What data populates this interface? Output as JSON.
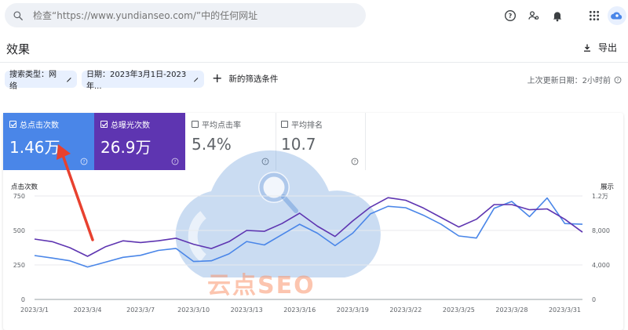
{
  "search": {
    "placeholder": "检查“https://www.yundianseo.com/”中的任何网址"
  },
  "header": {
    "title": "效果",
    "export_label": "导出"
  },
  "filters": {
    "search_type": "搜索类型：网络",
    "date": "日期：2023年3月1日-2023年...",
    "new_filter": "新的筛选条件",
    "last_updated": "上次更新日期：2小时前"
  },
  "metrics": [
    {
      "label": "总点击次数",
      "value": "1.46万",
      "checked": true,
      "color": "#4a86e8"
    },
    {
      "label": "总曝光次数",
      "value": "26.9万",
      "checked": true,
      "color": "#5e35b1"
    },
    {
      "label": "平均点击率",
      "value": "5.4%",
      "checked": false
    },
    {
      "label": "平均排名",
      "value": "10.7",
      "checked": false
    }
  ],
  "watermark": "云点SEO",
  "chart_data": {
    "type": "line",
    "left_axis_label": "点击次数",
    "right_axis_label": "展示",
    "left_ticks": [
      "750",
      "500",
      "250",
      "0"
    ],
    "right_ticks": [
      "1.2万",
      "8,000",
      "4,000",
      "0"
    ],
    "ylim_left": [
      0,
      750
    ],
    "ylim_right": [
      0,
      12000
    ],
    "x_tick_labels": [
      "2023/3/1",
      "2023/3/4",
      "2023/3/7",
      "2023/3/10",
      "2023/3/13",
      "2023/3/16",
      "2023/3/19",
      "2023/3/22",
      "2023/3/25",
      "2023/3/28",
      "2023/3/31"
    ],
    "x_tick_days": [
      1,
      4,
      7,
      10,
      13,
      16,
      19,
      22,
      25,
      28,
      31
    ],
    "days": [
      1,
      2,
      3,
      4,
      5,
      6,
      7,
      8,
      9,
      10,
      11,
      12,
      13,
      14,
      15,
      16,
      17,
      18,
      19,
      20,
      21,
      22,
      23,
      24,
      25,
      26,
      27,
      28,
      29,
      30,
      31,
      32
    ],
    "series": [
      {
        "name": "点击次数",
        "axis": "left",
        "color": "#4a86e8",
        "values": [
          318,
          300,
          280,
          235,
          270,
          305,
          320,
          355,
          370,
          275,
          280,
          330,
          420,
          395,
          470,
          545,
          480,
          390,
          480,
          620,
          675,
          665,
          610,
          545,
          460,
          445,
          660,
          710,
          600,
          735,
          550,
          545
        ]
      },
      {
        "name": "展示",
        "axis": "right",
        "color": "#5e35b1",
        "values": [
          7000,
          6700,
          6000,
          5000,
          6100,
          6800,
          6600,
          6800,
          7100,
          6400,
          5900,
          6700,
          8000,
          7900,
          8800,
          10000,
          8500,
          7300,
          9100,
          10700,
          11800,
          11500,
          10600,
          9500,
          8400,
          9300,
          11000,
          11000,
          10400,
          10500,
          9300,
          7800
        ]
      }
    ]
  }
}
